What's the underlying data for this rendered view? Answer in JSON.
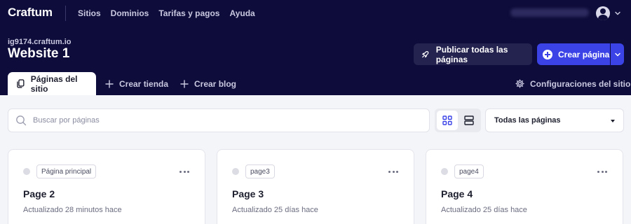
{
  "header": {
    "logo": "Craftum",
    "nav": [
      "Sitios",
      "Dominios",
      "Tarifas y pagos",
      "Ayuda"
    ]
  },
  "site": {
    "domain": "ig9174.craftum.io",
    "title": "Website 1"
  },
  "actions": {
    "publish_all": "Publicar todas las páginas",
    "create_page": "Crear página"
  },
  "tabs": {
    "pages": "Páginas del sitio",
    "store": "Crear tienda",
    "blog": "Crear blog",
    "settings": "Configuraciones del sitio"
  },
  "toolbar": {
    "search_placeholder": "Buscar por páginas",
    "filter_selected": "Todas las páginas"
  },
  "cards": [
    {
      "badge": "Página principal",
      "title": "Page 2",
      "updated": "Actualizado 28 minutos hace"
    },
    {
      "badge": "page3",
      "title": "Page 3",
      "updated": "Actualizado 25 días hace"
    },
    {
      "badge": "page4",
      "title": "Page 4",
      "updated": "Actualizado 25 días hace"
    }
  ],
  "colors": {
    "header_bg": "#0e0c3a",
    "accent": "#3b43e6"
  },
  "icons": [
    "avatar",
    "chevron-down-icon",
    "rocket-icon",
    "plus-circle-icon",
    "pages-icon",
    "plus-icon",
    "gear-icon",
    "search-icon",
    "grid-view-icon",
    "list-view-icon",
    "more-icon"
  ]
}
